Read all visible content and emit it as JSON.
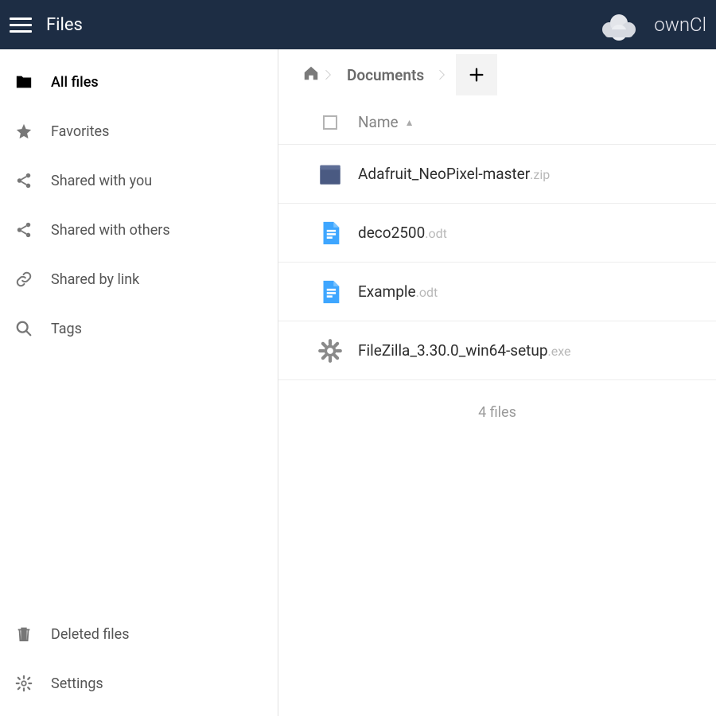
{
  "header": {
    "title": "Files",
    "brand": "ownCl"
  },
  "sidebar": {
    "items": [
      {
        "label": "All files",
        "icon": "folder",
        "active": true
      },
      {
        "label": "Favorites",
        "icon": "star",
        "active": false
      },
      {
        "label": "Shared with you",
        "icon": "share",
        "active": false
      },
      {
        "label": "Shared with others",
        "icon": "share",
        "active": false
      },
      {
        "label": "Shared by link",
        "icon": "link",
        "active": false
      },
      {
        "label": "Tags",
        "icon": "search",
        "active": false
      }
    ],
    "footer": [
      {
        "label": "Deleted files",
        "icon": "trash"
      },
      {
        "label": "Settings",
        "icon": "gear"
      }
    ]
  },
  "breadcrumb": {
    "current": "Documents"
  },
  "columns": {
    "name": "Name"
  },
  "files": [
    {
      "name": "Adafruit_NeoPixel-master",
      "ext": ".zip",
      "type": "archive"
    },
    {
      "name": "deco2500",
      "ext": ".odt",
      "type": "doc"
    },
    {
      "name": "Example",
      "ext": ".odt",
      "type": "doc"
    },
    {
      "name": "FileZilla_3.30.0_win64-setup",
      "ext": ".exe",
      "type": "exe"
    }
  ],
  "summary": "4 files"
}
